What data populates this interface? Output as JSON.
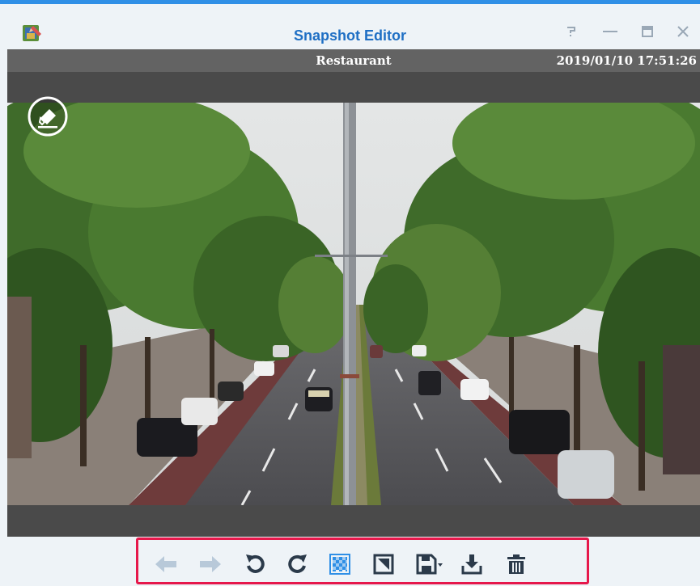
{
  "window": {
    "title": "Snapshot Editor",
    "controls": [
      "help",
      "minimize",
      "maximize",
      "close"
    ]
  },
  "infobar": {
    "camera_name": "Restaurant",
    "timestamp": "2019/01/10 17:51:26"
  },
  "viewer": {
    "overlay_tool": "eraser-icon",
    "background": "#4a4a4a"
  },
  "toolbar": {
    "tools": [
      {
        "name": "previous-snapshot",
        "icon": "arrow-left-icon",
        "enabled": false
      },
      {
        "name": "next-snapshot",
        "icon": "arrow-right-icon",
        "enabled": false
      },
      {
        "name": "rotate-counterclockwise",
        "icon": "rotate-ccw-icon",
        "enabled": true
      },
      {
        "name": "rotate-clockwise",
        "icon": "rotate-cw-icon",
        "enabled": true
      },
      {
        "name": "mosaic",
        "icon": "mosaic-icon",
        "enabled": true,
        "active": true
      },
      {
        "name": "crop",
        "icon": "crop-icon",
        "enabled": true
      },
      {
        "name": "save",
        "icon": "save-dropdown-icon",
        "enabled": true
      },
      {
        "name": "download",
        "icon": "download-icon",
        "enabled": true
      },
      {
        "name": "delete",
        "icon": "trash-icon",
        "enabled": true
      }
    ]
  },
  "colors": {
    "accent": "#2f8fe6",
    "title": "#1f6fc4",
    "toolbar_highlight": "#e6184b",
    "icon": "#2b3a4a",
    "icon_disabled": "#b8c9d9",
    "infobar": "#636363"
  }
}
